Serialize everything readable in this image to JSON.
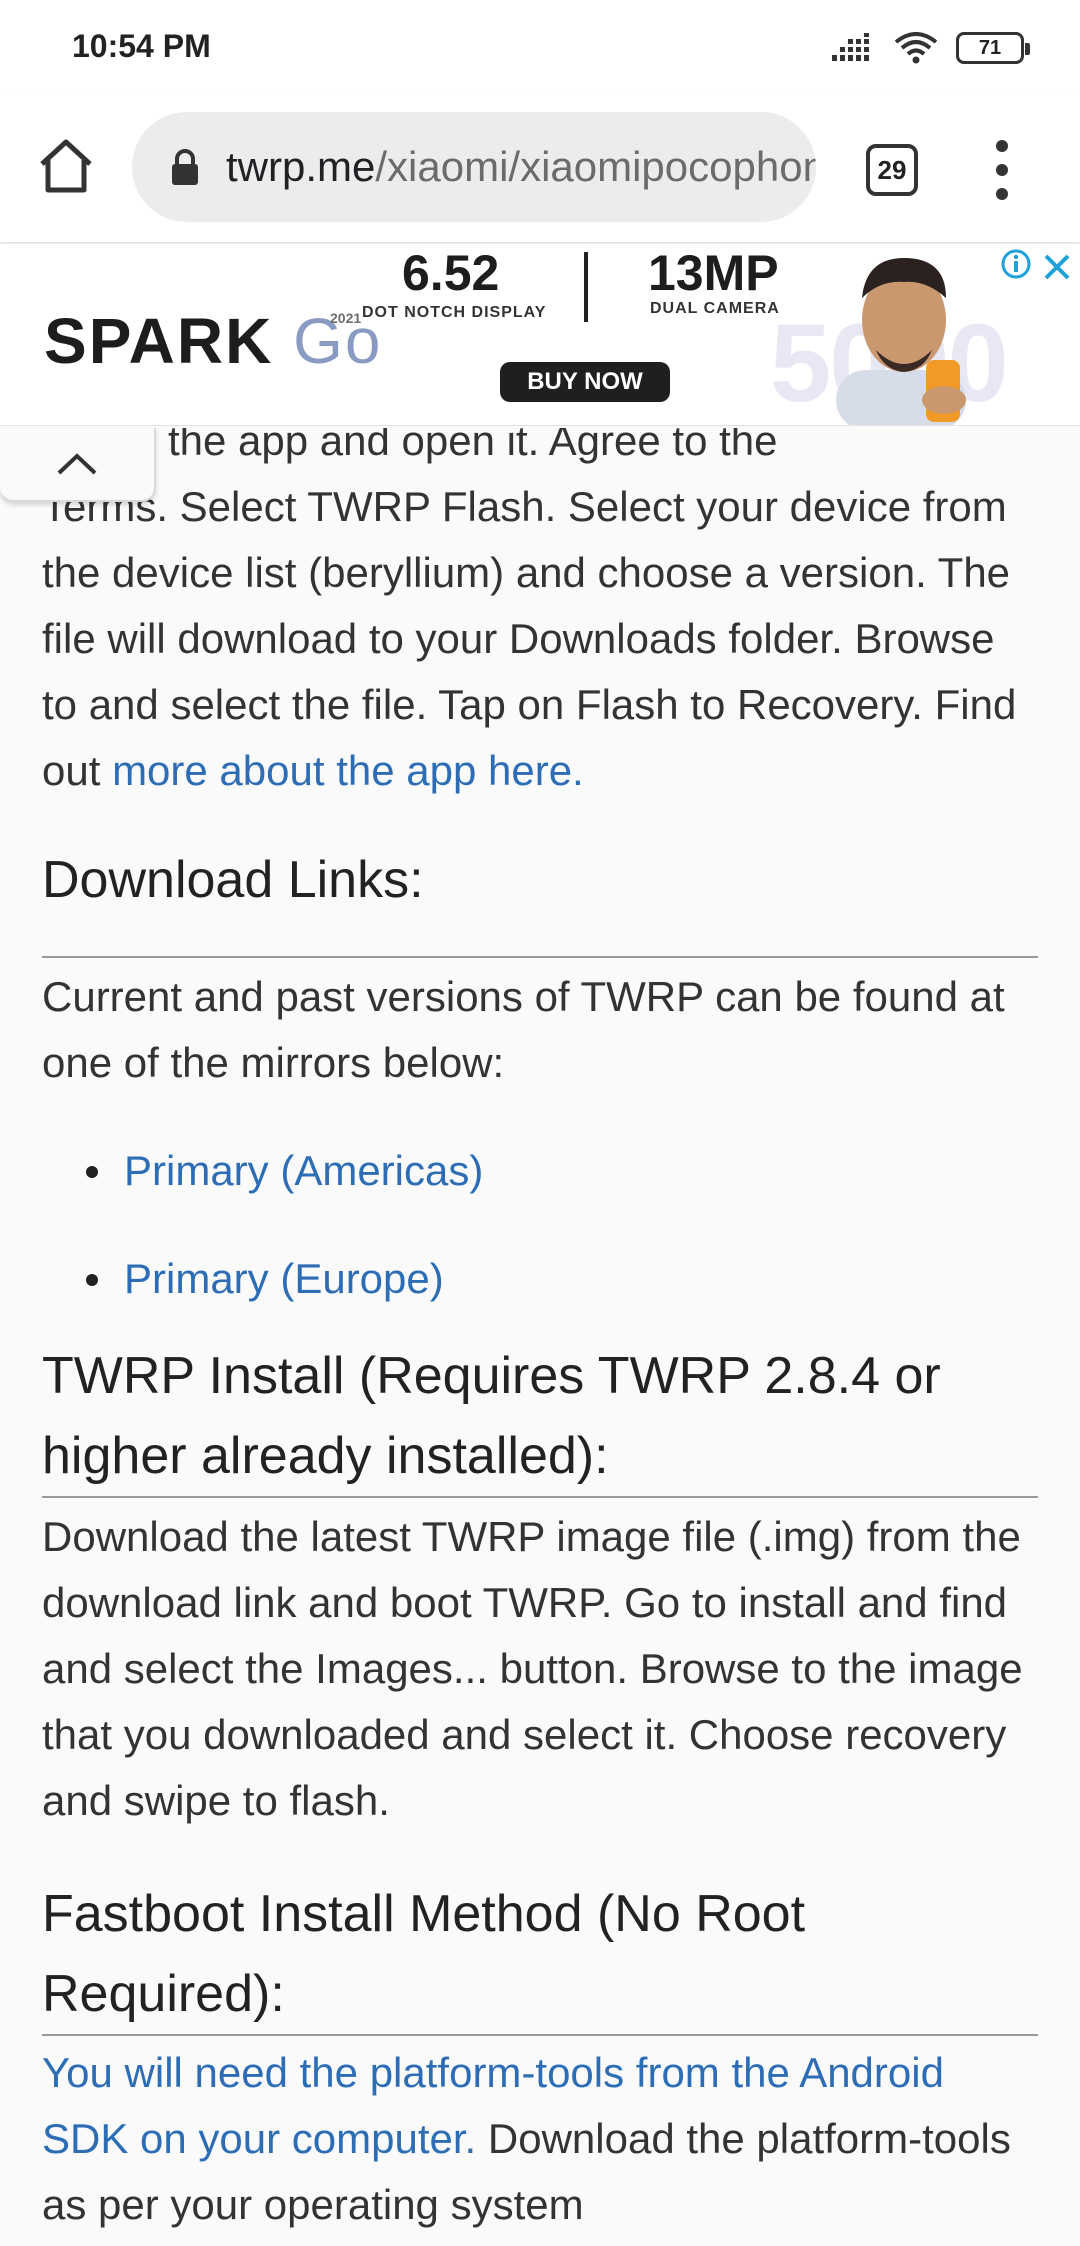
{
  "status_bar": {
    "time": "10:54 PM",
    "battery": "71"
  },
  "browser": {
    "url_domain": "twrp.me",
    "url_path": "/xiaomi/xiaomipocophone",
    "tab_count": "29"
  },
  "ad": {
    "brand": "SPARK",
    "brand_suffix": "Go",
    "year": "2021",
    "spec1_value": "6.52",
    "spec1_label": "DOT NOTCH DISPLAY",
    "spec2_value": "13MP",
    "spec2_label": "DUAL CAMERA",
    "cta": "BUY NOW",
    "big_text": "5000"
  },
  "content": {
    "intro_partial_line": "the app and open it. Agree to the",
    "intro_text": "Terms. Select TWRP Flash. Select your device from the device list (beryllium) and choose a version. The file will download to your Downloads folder. Browse to and select the file. Tap on Flash to Recovery. Find out ",
    "intro_link": "more about the app here.",
    "download_heading": "Download Links:",
    "download_text": "Current and past versions of TWRP can be found at one of the mirrors below:",
    "mirrors": [
      "Primary (Americas)",
      "Primary (Europe)"
    ],
    "twrp_install_heading": "TWRP Install (Requires TWRP 2.8.4 or higher already installed):",
    "twrp_install_text": "Download the latest TWRP image file (.img) from the download link and boot TWRP. Go to install and find and select the Images... button. Browse to the image that you downloaded and select it. Choose recovery and swipe to flash.",
    "fastboot_heading": "Fastboot Install Method (No Root Required):",
    "fastboot_link": "You will need the platform-tools from the Android SDK on your computer.",
    "fastboot_text": " Download the platform-tools as per your operating system"
  }
}
